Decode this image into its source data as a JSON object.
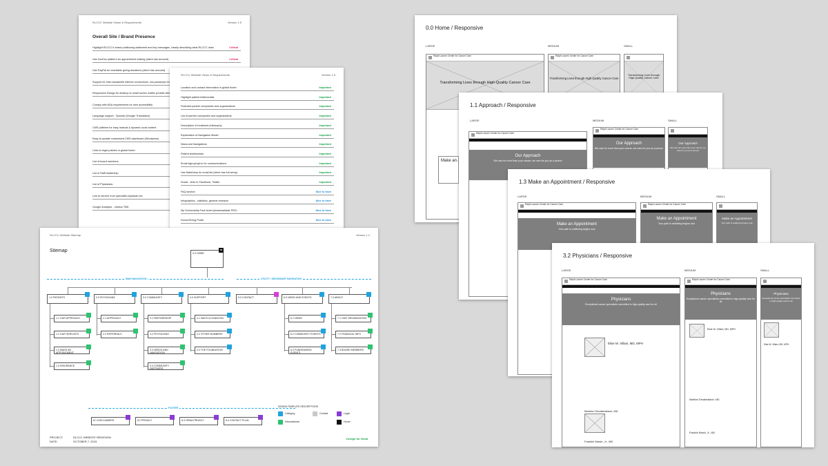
{
  "req_doc_1": {
    "header": "RLCCC Website Vision & Requirements",
    "version": "Version 1.5",
    "title": "Overall Site / Brand Presence",
    "rows": [
      {
        "text": "Highlight RLCCC's brand positioning statement and key messages, clearly describing what RLCCC does",
        "priority": "Critical",
        "level": "crit"
      },
      {
        "text": "Use ZocDoc platform for appointment making (client has account)",
        "priority": "Critical",
        "level": "crit"
      },
      {
        "text": "Use PayPal for charitable giving donations (client has account)",
        "priority": "Critical",
        "level": "crit"
      },
      {
        "text": "Support for inter-bandwidth internet connections, non-javascript enabled browsers",
        "priority": "",
        "level": "crit"
      },
      {
        "text": "Responsive Design for desktop to small screen widths (mobile-friendly)",
        "priority": "",
        "level": "crit"
      },
      {
        "text": "Comply with ADA requirements for web accessibility",
        "priority": "",
        "level": "crit"
      },
      {
        "text": "Language support - Spanish (Google Translation)",
        "priority": "",
        "level": "crit"
      },
      {
        "text": "CMS platform for easy manual & dynamic local content",
        "priority": "",
        "level": "crit"
      },
      {
        "text": "Easy-to-update customized CMS dashboard (Wordpress)",
        "priority": "",
        "level": "crit"
      },
      {
        "text": "Links to legal policies in global footer",
        "priority": "",
        "level": "crit"
      },
      {
        "text": "List of board members",
        "priority": "",
        "level": "crit"
      },
      {
        "text": "List of Staff leadership",
        "priority": "",
        "level": "crit"
      },
      {
        "text": "List of Physicians",
        "priority": "",
        "level": "crit"
      },
      {
        "text": "Link to service from specialist physician bio",
        "priority": "",
        "level": "crit"
      },
      {
        "text": "Google Analytics - metrics TBD",
        "priority": "",
        "level": "crit"
      }
    ]
  },
  "req_doc_2": {
    "header": "RLCCC Website Vision & Requirements",
    "version": "Version 1.5",
    "rows": [
      {
        "text": "Location and contact information in global footer",
        "priority": "Important",
        "level": "imp"
      },
      {
        "text": "Highlight patient testimonials",
        "priority": "Important",
        "level": "imp"
      },
      {
        "text": "Featured partner companies and organizations",
        "priority": "Important",
        "level": "imp"
      },
      {
        "text": "List of partner companies and organizations",
        "priority": "Important",
        "level": "imp"
      },
      {
        "text": "Description of treatment philosophy",
        "priority": "Important",
        "level": "imp"
      },
      {
        "text": "Explanation of Navigation Model",
        "priority": "Important",
        "level": "imp"
      },
      {
        "text": "News and Navigations",
        "priority": "Important",
        "level": "imp"
      },
      {
        "text": "Patient testimonials",
        "priority": "Important",
        "level": "imp"
      },
      {
        "text": "Email signup/opt-in for communications",
        "priority": "Important",
        "level": "imp"
      },
      {
        "text": "Use Mailchimp for email list (client has full setup)",
        "priority": "Important",
        "level": "imp"
      },
      {
        "text": "Social - links to Facebook, Twitter",
        "priority": "Important",
        "level": "imp"
      },
      {
        "text": "FAQ section",
        "priority": "Nice to have",
        "level": "nice"
      },
      {
        "text": "Infographics - statistics, general research",
        "priority": "Nice to have",
        "level": "nice"
      },
      {
        "text": "My Survivorship Fact sheet (downloadable PDF)",
        "priority": "Nice to have",
        "level": "nice"
      },
      {
        "text": "Donor/Giving Portal",
        "priority": "Nice to have",
        "level": "nice"
      }
    ]
  },
  "sitemap": {
    "header": "RLCCC Website Sitemap",
    "version": "Version 1.2",
    "title": "Sitemap",
    "home": "0.0 HOME",
    "main_nav_label": "MAIN NAVIGATION",
    "utility_nav_label": "UTILITY / SECONDARY NAVIGATION",
    "footer_label": "FOOTER",
    "level1": [
      "1.0 PATIENTS",
      "2.0 PHYSICIANS",
      "3.0 COMMUNITY",
      "4.0 SUPPORT",
      "5.0 CONTACT",
      "6.0 NEWS AND EVENTS",
      "7.0 ABOUT"
    ],
    "patients_children": [
      "1.1 OUR APPROACH",
      "1.2 OUR SERVICES",
      "1.3 MAKE AN APPOINTMENT",
      "1.4 INSURANCE"
    ],
    "physicians_children": [
      "2.1 APPROACH",
      "2.2 REFERRALS"
    ],
    "community_children": [
      "3.1 PARTNERSHIP",
      "3.2 PHYSICIANS",
      "3.3 NEEDS AND NAVIGATION",
      "3.4 COMMUNITY PARTNERS"
    ],
    "support_children": [
      "4.1 WAYS A DONATION",
      "4.2 OTHER NUMBERS",
      "4.3 THE FOUNDATION"
    ],
    "news_children": [
      "6.1 NEWS",
      "6.2 COMMUNITY EVENTS",
      "6.3 FUNDRAISING EVENTS"
    ],
    "about_children": [
      "7.1 OUR ORGANIZATION",
      "7.2 FINANCIAL INFO",
      "7.3 BOARD MEMBERS"
    ],
    "footer_items": [
      "8.1 DISCLAIMERS",
      "8.2 PRIVACY",
      "8.3 HIPAA PRIVACY",
      "8.4 CONTACT PLAN"
    ],
    "legend_title": "DESIGN TEMPLATE DESCRIPTIONS",
    "legend": [
      {
        "label": "Category",
        "color": "#1ea3e0"
      },
      {
        "label": "Contact",
        "color": "#c8c8c8"
      },
      {
        "label": "Legal",
        "color": "#8a3bd6"
      },
      {
        "label": "Informational",
        "color": "#2ec371"
      },
      {
        "label": "Home",
        "color": "#111111"
      }
    ],
    "project_label": "PROJECT:",
    "project_value": "RLCCC WEBSITE REDESIGN",
    "date_label": "DATE:",
    "date_value": "OCTOBER 7, 2015",
    "credit": "Design for Good"
  },
  "wireframes": [
    {
      "title": "0.0 Home / Responsive",
      "hero": "Transforming Lives through High-Quality Cancer Care",
      "hero_small": "Transforming Lives through High-Quality Cancer Care"
    },
    {
      "title": "1.1 Approach / Responsive",
      "hero": "Our Approach",
      "sub": "We care for more than your cancer; we care for you as a person",
      "cta": "Make an Appointment"
    },
    {
      "title": "1.3 Make an Appointment / Responsive",
      "hero": "Make an Appointment",
      "sub": "Your path to wellbeing begins now",
      "body_heading": "We welcome new patients"
    },
    {
      "title": "3.2 Physicians / Responsive",
      "hero": "Physicians",
      "sub": "Exceptional cancer specialists committed to high-quality care for all",
      "doctors": [
        "Elsie M. Villani, MD, MPH",
        "Madhuri Devabhaktuni, MD",
        "Franklin Marsh, Jr., MD"
      ]
    }
  ],
  "size_labels": {
    "large": "LARGE",
    "medium": "MEDIUM",
    "small": "SMALL"
  },
  "brand": "Ralph Lauren Center for Cancer Care"
}
